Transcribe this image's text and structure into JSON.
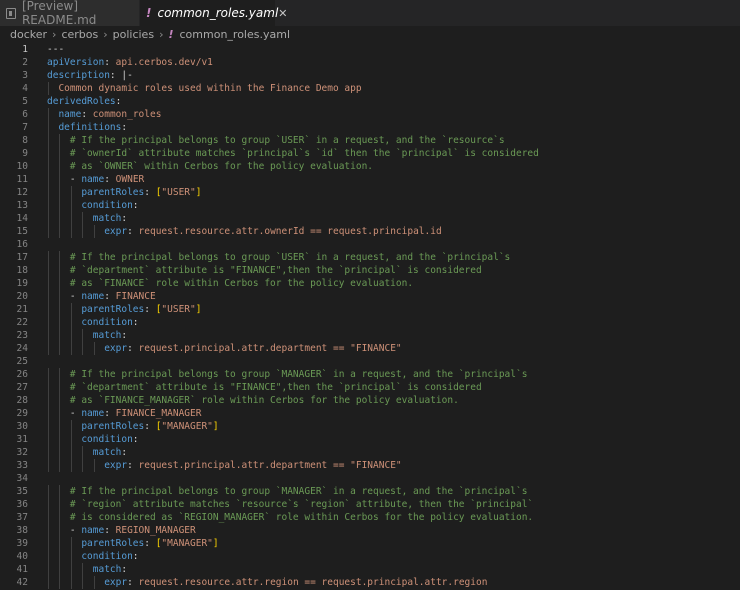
{
  "tabs": [
    {
      "label": "[Preview] README.md",
      "icon": "preview-icon"
    },
    {
      "label": "common_roles.yaml",
      "icon": "yaml-icon",
      "close": "✕"
    }
  ],
  "breadcrumb": [
    "docker",
    "cerbos",
    "policies",
    "common_roles.yaml"
  ],
  "lines": [
    [
      [
        "d",
        "---"
      ]
    ],
    [
      [
        "k",
        "apiVersion"
      ],
      [
        "p",
        ": "
      ],
      [
        "s",
        "api.cerbos.dev/v1"
      ]
    ],
    [
      [
        "k",
        "description"
      ],
      [
        "p",
        ": "
      ],
      [
        "p",
        "|-"
      ]
    ],
    [
      [
        "s",
        "Common dynamic roles used within the Finance Demo app"
      ]
    ],
    [
      [
        "k",
        "derivedRoles"
      ],
      [
        "p",
        ":"
      ]
    ],
    [
      [
        "k",
        "name"
      ],
      [
        "p",
        ": "
      ],
      [
        "s",
        "common_roles"
      ]
    ],
    [
      [
        "k",
        "definitions"
      ],
      [
        "p",
        ":"
      ]
    ],
    [
      [
        "c",
        "# If the principal belongs to group `USER` in a request, and the `resource`s"
      ]
    ],
    [
      [
        "c",
        "# `ownerId` attribute matches `principal`s `id` then the `principal` is considered"
      ]
    ],
    [
      [
        "c",
        "# as `OWNER` within Cerbos for the policy evaluation."
      ]
    ],
    [
      [
        "p",
        "- "
      ],
      [
        "k",
        "name"
      ],
      [
        "p",
        ": "
      ],
      [
        "s",
        "OWNER"
      ]
    ],
    [
      [
        "k",
        "parentRoles"
      ],
      [
        "p",
        ": "
      ],
      [
        "b",
        "["
      ],
      [
        "s",
        "\"USER\""
      ],
      [
        "b",
        "]"
      ]
    ],
    [
      [
        "k",
        "condition"
      ],
      [
        "p",
        ":"
      ]
    ],
    [
      [
        "k",
        "match"
      ],
      [
        "p",
        ":"
      ]
    ],
    [
      [
        "k",
        "expr"
      ],
      [
        "p",
        ": "
      ],
      [
        "s",
        "request.resource.attr.ownerId == request.principal.id"
      ]
    ],
    [],
    [
      [
        "c",
        "# If the principal belongs to group `USER` in a request, and the `principal`s"
      ]
    ],
    [
      [
        "c",
        "# `department` attribute is \"FINANCE\",then the `principal` is considered"
      ]
    ],
    [
      [
        "c",
        "# as `FINANCE` role within Cerbos for the policy evaluation."
      ]
    ],
    [
      [
        "p",
        "- "
      ],
      [
        "k",
        "name"
      ],
      [
        "p",
        ": "
      ],
      [
        "s",
        "FINANCE"
      ]
    ],
    [
      [
        "k",
        "parentRoles"
      ],
      [
        "p",
        ": "
      ],
      [
        "b",
        "["
      ],
      [
        "s",
        "\"USER\""
      ],
      [
        "b",
        "]"
      ]
    ],
    [
      [
        "k",
        "condition"
      ],
      [
        "p",
        ":"
      ]
    ],
    [
      [
        "k",
        "match"
      ],
      [
        "p",
        ":"
      ]
    ],
    [
      [
        "k",
        "expr"
      ],
      [
        "p",
        ": "
      ],
      [
        "s",
        "request.principal.attr.department == \"FINANCE\""
      ]
    ],
    [],
    [
      [
        "c",
        "# If the principal belongs to group `MANAGER` in a request, and the `principal`s"
      ]
    ],
    [
      [
        "c",
        "# `department` attribute is \"FINANCE\",then the `principal` is considered"
      ]
    ],
    [
      [
        "c",
        "# as `FINANCE_MANAGER` role within Cerbos for the policy evaluation."
      ]
    ],
    [
      [
        "p",
        "- "
      ],
      [
        "k",
        "name"
      ],
      [
        "p",
        ": "
      ],
      [
        "s",
        "FINANCE_MANAGER"
      ]
    ],
    [
      [
        "k",
        "parentRoles"
      ],
      [
        "p",
        ": "
      ],
      [
        "b",
        "["
      ],
      [
        "s",
        "\"MANAGER\""
      ],
      [
        "b",
        "]"
      ]
    ],
    [
      [
        "k",
        "condition"
      ],
      [
        "p",
        ":"
      ]
    ],
    [
      [
        "k",
        "match"
      ],
      [
        "p",
        ":"
      ]
    ],
    [
      [
        "k",
        "expr"
      ],
      [
        "p",
        ": "
      ],
      [
        "s",
        "request.principal.attr.department == \"FINANCE\""
      ]
    ],
    [],
    [
      [
        "c",
        "# If the principal belongs to group `MANAGER` in a request, and the `principal`s"
      ]
    ],
    [
      [
        "c",
        "# `region` attribute matches `resource`s `region` attribute, then the `principal`"
      ]
    ],
    [
      [
        "c",
        "# is considered as `REGION_MANAGER` role within Cerbos for the policy evaluation."
      ]
    ],
    [
      [
        "p",
        "- "
      ],
      [
        "k",
        "name"
      ],
      [
        "p",
        ": "
      ],
      [
        "s",
        "REGION_MANAGER"
      ]
    ],
    [
      [
        "k",
        "parentRoles"
      ],
      [
        "p",
        ": "
      ],
      [
        "b",
        "["
      ],
      [
        "s",
        "\"MANAGER\""
      ],
      [
        "b",
        "]"
      ]
    ],
    [
      [
        "k",
        "condition"
      ],
      [
        "p",
        ":"
      ]
    ],
    [
      [
        "k",
        "match"
      ],
      [
        "p",
        ":"
      ]
    ],
    [
      [
        "k",
        "expr"
      ],
      [
        "p",
        ": "
      ],
      [
        "s",
        "request.resource.attr.region == request.principal.attr.region"
      ]
    ]
  ],
  "colors": {
    "key": "#569cd6",
    "string": "#ce9178",
    "comment": "#6a9955",
    "bracket": "#ffd700",
    "yaml_icon": "#c586c0"
  }
}
